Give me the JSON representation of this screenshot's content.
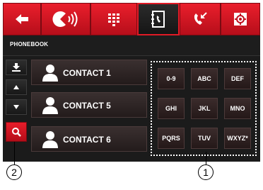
{
  "toolbar": {
    "tabs": [
      {
        "name": "back",
        "icon": "back-arrow-icon"
      },
      {
        "name": "audio",
        "icon": "speaker-icon"
      },
      {
        "name": "keypad",
        "icon": "dialpad-icon"
      },
      {
        "name": "phonebook",
        "icon": "phonebook-icon",
        "active": true
      },
      {
        "name": "recent-calls",
        "icon": "call-log-icon"
      },
      {
        "name": "settings",
        "icon": "gear-icon"
      }
    ],
    "accent_color": "#e01a26"
  },
  "page_title": "PHONEBOOK",
  "side_buttons": [
    {
      "icon": "download-icon"
    },
    {
      "icon": "arrow-up-icon"
    },
    {
      "icon": "arrow-down-icon"
    },
    {
      "icon": "search-icon"
    }
  ],
  "contacts": [
    {
      "label": "CONTACT 1"
    },
    {
      "label": "CONTACT 5"
    },
    {
      "label": "CONTACT 6"
    }
  ],
  "keypad": {
    "keys": [
      "0-9",
      "ABC",
      "DEF",
      "GHI",
      "JKL",
      "MNO",
      "PQRS",
      "TUV",
      "WXYZ*"
    ]
  },
  "callouts": {
    "search": "2",
    "keypad": "1"
  }
}
